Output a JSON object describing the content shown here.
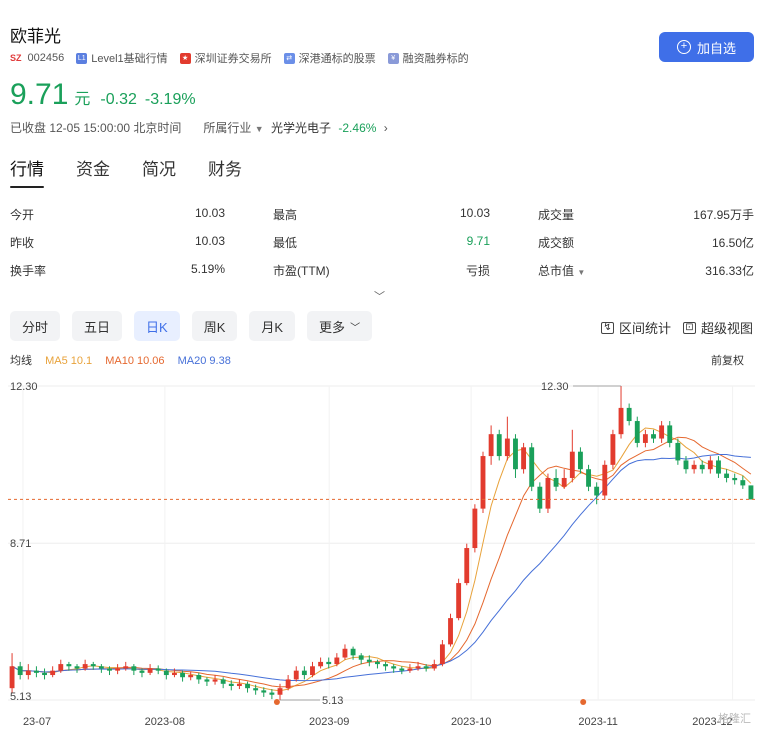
{
  "header": {
    "name": "欧菲光",
    "exchange_tag": "SZ",
    "code": "002456",
    "tags": [
      {
        "icon": "level1-icon",
        "label": "Level1基础行情"
      },
      {
        "icon": "china-flag-icon",
        "label": "深圳证券交易所"
      },
      {
        "icon": "connect-icon",
        "label": "深港通标的股票"
      },
      {
        "icon": "margin-icon",
        "label": "融资融券标的"
      }
    ],
    "add_button": "加自选"
  },
  "quote": {
    "price": "9.71",
    "unit": "元",
    "change": "-0.32",
    "change_pct": "-3.19%",
    "status": "已收盘 12-05 15:00:00 北京时间",
    "industry_label": "所属行业",
    "industry_name": "光学光电子",
    "industry_change": "-2.46%"
  },
  "tabs": [
    "行情",
    "资金",
    "简况",
    "财务"
  ],
  "stats": [
    [
      {
        "label": "今开",
        "value": "10.03"
      },
      {
        "label": "最高",
        "value": "10.03"
      },
      {
        "label": "成交量",
        "value": "167.95万手"
      }
    ],
    [
      {
        "label": "昨收",
        "value": "10.03"
      },
      {
        "label": "最低",
        "value": "9.71"
      },
      {
        "label": "成交额",
        "value": "16.50亿"
      }
    ],
    [
      {
        "label": "换手率",
        "value": "5.19%"
      },
      {
        "label": "市盈(TTM)",
        "value": "亏损"
      },
      {
        "label": "总市值",
        "value": "316.33亿"
      }
    ]
  ],
  "periods": [
    "分时",
    "五日",
    "日K",
    "周K",
    "月K",
    "更多"
  ],
  "active_period": "日K",
  "tools": {
    "range_stats": "区间统计",
    "super_view": "超级视图"
  },
  "ma_legend": {
    "label": "均线",
    "ma5": "MA5 10.1",
    "ma10": "MA10 10.06",
    "ma20": "MA20 9.38",
    "adjust": "前复权"
  },
  "colors": {
    "up": "#e23b2e",
    "down": "#1aa05a",
    "accent": "#3f6fe8",
    "ma5": "#e8a23a",
    "ma10": "#e5682f",
    "ma20": "#4670d8"
  },
  "chart_data": {
    "type": "candlestick",
    "y_ticks": [
      "12.30",
      "8.71",
      "5.13"
    ],
    "ylim": [
      5.13,
      12.3
    ],
    "x_ticks": [
      "23-07",
      "2023-08",
      "2023-09",
      "2023-10",
      "2023-11",
      "2023-12"
    ],
    "high_label": "12.30",
    "low_label": "5.13",
    "last_close": 9.71,
    "candles": [
      [
        5.4,
        5.9,
        6.2,
        5.3
      ],
      [
        5.9,
        5.7,
        6.0,
        5.6
      ],
      [
        5.7,
        5.8,
        5.95,
        5.6
      ],
      [
        5.8,
        5.75,
        5.9,
        5.65
      ],
      [
        5.75,
        5.7,
        5.85,
        5.6
      ],
      [
        5.7,
        5.8,
        5.9,
        5.65
      ],
      [
        5.8,
        5.95,
        6.05,
        5.75
      ],
      [
        5.95,
        5.9,
        6.0,
        5.8
      ],
      [
        5.9,
        5.85,
        5.95,
        5.75
      ],
      [
        5.85,
        5.95,
        6.05,
        5.8
      ],
      [
        5.95,
        5.9,
        6.0,
        5.82
      ],
      [
        5.9,
        5.85,
        5.95,
        5.75
      ],
      [
        5.85,
        5.8,
        5.9,
        5.7
      ],
      [
        5.8,
        5.85,
        5.95,
        5.72
      ],
      [
        5.85,
        5.9,
        6.0,
        5.8
      ],
      [
        5.9,
        5.8,
        5.95,
        5.7
      ],
      [
        5.8,
        5.75,
        5.85,
        5.65
      ],
      [
        5.75,
        5.85,
        5.95,
        5.7
      ],
      [
        5.85,
        5.8,
        5.92,
        5.72
      ],
      [
        5.8,
        5.7,
        5.85,
        5.6
      ],
      [
        5.7,
        5.75,
        5.85,
        5.65
      ],
      [
        5.75,
        5.65,
        5.8,
        5.55
      ],
      [
        5.65,
        5.7,
        5.78,
        5.58
      ],
      [
        5.7,
        5.6,
        5.75,
        5.5
      ],
      [
        5.6,
        5.55,
        5.65,
        5.45
      ],
      [
        5.55,
        5.6,
        5.7,
        5.48
      ],
      [
        5.6,
        5.5,
        5.65,
        5.4
      ],
      [
        5.5,
        5.45,
        5.58,
        5.35
      ],
      [
        5.45,
        5.5,
        5.6,
        5.38
      ],
      [
        5.5,
        5.4,
        5.55,
        5.3
      ],
      [
        5.4,
        5.35,
        5.48,
        5.25
      ],
      [
        5.35,
        5.3,
        5.42,
        5.2
      ],
      [
        5.3,
        5.25,
        5.38,
        5.15
      ],
      [
        5.25,
        5.4,
        5.5,
        5.13
      ],
      [
        5.4,
        5.6,
        5.7,
        5.35
      ],
      [
        5.6,
        5.8,
        5.9,
        5.55
      ],
      [
        5.8,
        5.7,
        5.9,
        5.6
      ],
      [
        5.7,
        5.9,
        6.0,
        5.65
      ],
      [
        5.9,
        6.0,
        6.1,
        5.85
      ],
      [
        6.0,
        5.95,
        6.1,
        5.85
      ],
      [
        5.95,
        6.1,
        6.2,
        5.9
      ],
      [
        6.1,
        6.3,
        6.4,
        6.05
      ],
      [
        6.3,
        6.15,
        6.35,
        6.05
      ],
      [
        6.15,
        6.05,
        6.2,
        5.95
      ],
      [
        6.05,
        6.0,
        6.15,
        5.9
      ],
      [
        6.0,
        5.95,
        6.05,
        5.85
      ],
      [
        5.95,
        5.9,
        6.0,
        5.8
      ],
      [
        5.9,
        5.85,
        5.95,
        5.75
      ],
      [
        5.85,
        5.8,
        5.9,
        5.72
      ],
      [
        5.8,
        5.85,
        5.95,
        5.75
      ],
      [
        5.85,
        5.9,
        6.0,
        5.8
      ],
      [
        5.9,
        5.85,
        5.95,
        5.78
      ],
      [
        5.85,
        5.95,
        6.05,
        5.8
      ],
      [
        5.95,
        6.4,
        6.5,
        5.9
      ],
      [
        6.4,
        7.0,
        7.1,
        6.35
      ],
      [
        7.0,
        7.8,
        7.9,
        6.95
      ],
      [
        7.8,
        8.6,
        8.7,
        7.75
      ],
      [
        8.6,
        9.5,
        9.6,
        8.5
      ],
      [
        9.5,
        10.7,
        10.8,
        9.4
      ],
      [
        10.7,
        11.2,
        11.4,
        10.5
      ],
      [
        11.2,
        10.7,
        11.3,
        10.6
      ],
      [
        10.7,
        11.1,
        11.6,
        10.6
      ],
      [
        11.1,
        10.4,
        11.2,
        10.2
      ],
      [
        10.4,
        10.9,
        11.0,
        10.3
      ],
      [
        10.9,
        10.0,
        11.0,
        9.9
      ],
      [
        10.0,
        9.5,
        10.1,
        9.4
      ],
      [
        9.5,
        10.2,
        10.3,
        9.4
      ],
      [
        10.2,
        10.0,
        10.4,
        9.9
      ],
      [
        10.0,
        10.2,
        10.4,
        9.95
      ],
      [
        10.2,
        10.8,
        11.3,
        10.1
      ],
      [
        10.8,
        10.4,
        10.9,
        10.3
      ],
      [
        10.4,
        10.0,
        10.5,
        9.9
      ],
      [
        10.0,
        9.8,
        10.1,
        9.6
      ],
      [
        9.8,
        10.5,
        10.6,
        9.7
      ],
      [
        10.5,
        11.2,
        11.3,
        10.4
      ],
      [
        11.2,
        11.8,
        12.3,
        11.1
      ],
      [
        11.8,
        11.5,
        11.9,
        11.4
      ],
      [
        11.5,
        11.0,
        11.6,
        10.9
      ],
      [
        11.0,
        11.2,
        11.3,
        10.9
      ],
      [
        11.2,
        11.1,
        11.3,
        11.0
      ],
      [
        11.1,
        11.4,
        11.5,
        11.0
      ],
      [
        11.4,
        11.0,
        11.5,
        10.9
      ],
      [
        11.0,
        10.6,
        11.1,
        10.5
      ],
      [
        10.6,
        10.4,
        10.7,
        10.3
      ],
      [
        10.4,
        10.5,
        10.6,
        10.3
      ],
      [
        10.5,
        10.4,
        10.6,
        10.3
      ],
      [
        10.4,
        10.6,
        10.7,
        10.3
      ],
      [
        10.6,
        10.3,
        10.7,
        10.2
      ],
      [
        10.3,
        10.2,
        10.4,
        10.1
      ],
      [
        10.2,
        10.15,
        10.3,
        10.05
      ],
      [
        10.15,
        10.03,
        10.25,
        9.95
      ],
      [
        10.03,
        9.71,
        10.03,
        9.71
      ]
    ],
    "markers": [
      "2023-08-end",
      "2023-11"
    ]
  },
  "watermark": "格隆汇"
}
